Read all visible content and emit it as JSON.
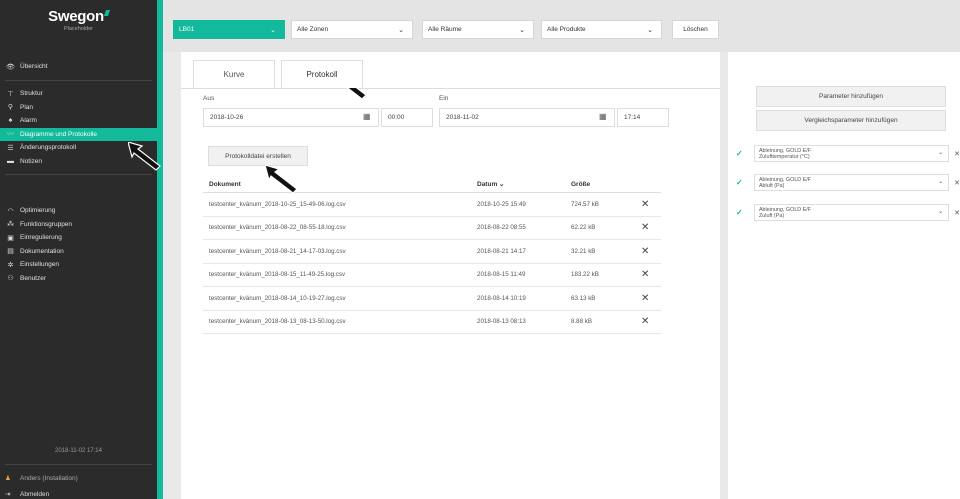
{
  "brand": {
    "name": "Swegon",
    "subtitle": "Placeholder"
  },
  "nav": {
    "overview": {
      "label": "Übersicht",
      "icon": "eye-icon"
    },
    "items": [
      {
        "label": "Struktur",
        "icon": "structure-icon"
      },
      {
        "label": "Plan",
        "icon": "map-pin-icon"
      },
      {
        "label": "Alarm",
        "icon": "bell-icon"
      },
      {
        "label": "Diagramme und Protokolle",
        "icon": "chart-icon",
        "active": true
      },
      {
        "label": "Änderungsprotokoll",
        "icon": "list-icon"
      },
      {
        "label": "Notizen",
        "icon": "note-icon"
      }
    ],
    "items2": [
      {
        "label": "Optimierung",
        "icon": "gauge-icon"
      },
      {
        "label": "Funktionsgruppen",
        "icon": "group-icon"
      },
      {
        "label": "Einregulierung",
        "icon": "tune-icon"
      },
      {
        "label": "Dokumentation",
        "icon": "document-icon"
      },
      {
        "label": "Einstellungen",
        "icon": "gear-icon"
      },
      {
        "label": "Benutzer",
        "icon": "users-icon"
      }
    ],
    "datetime": "2018-11-02 17:14",
    "user": "Anders (Installation)",
    "logout": "Abmelden"
  },
  "filters": {
    "unit": "LB01",
    "zones": "Alle Zonen",
    "rooms": "Alle Räume",
    "products": "Alle Produkte",
    "clear": "Löschen"
  },
  "tabs": {
    "curve": "Kurve",
    "log": "Protokoll"
  },
  "range": {
    "from_label": "Aus",
    "from_date": "2018-10-26",
    "from_time": "00:00",
    "to_label": "Ein",
    "to_date": "2018-11-02",
    "to_time": "17:14"
  },
  "create_button": "Protokolldatei erstellen",
  "table": {
    "headers": {
      "doc": "Dokument",
      "date": "Datum ⌄",
      "size": "Größe"
    },
    "rows": [
      {
        "doc": "testcenter_kvänum_2018-10-25_15-49-06.log.csv",
        "date": "2018-10-25 15:49",
        "size": "724.57 kB"
      },
      {
        "doc": "testcenter_kvänum_2018-08-22_08-55-18.log.csv",
        "date": "2018-08-22 08:55",
        "size": "62.22 kB"
      },
      {
        "doc": "testcenter_kvänum_2018-08-21_14-17-03.log.csv",
        "date": "2018-08-21 14:17",
        "size": "32.21 kB"
      },
      {
        "doc": "testcenter_kvänum_2018-08-15_11-49-25.log.csv",
        "date": "2018-08-15 11:49",
        "size": "183.22 kB"
      },
      {
        "doc": "testcenter_kvänum_2018-08-14_10-19-27.log.csv",
        "date": "2018-08-14 10:19",
        "size": "63.13 kB"
      },
      {
        "doc": "testcenter_kvänum_2018-08-13_08-13-50.log.csv",
        "date": "2018-08-13 08:13",
        "size": "8.88 kB"
      }
    ],
    "delete_glyph": "✕"
  },
  "right": {
    "add_param": "Parameter hinzufügen",
    "add_compare": "Vergleichsparameter hinzufügen",
    "params": [
      {
        "line1": "Ableinung, GOLD E/F",
        "line2": "Zulufttemperatur (°C)"
      },
      {
        "line1": "Ableinung, GOLD E/F",
        "line2": "Abluft (Pa)"
      },
      {
        "line1": "Ableinung, GOLD E/F",
        "line2": "Zuluft (Pa)"
      }
    ]
  },
  "colors": {
    "accent": "#12b99a",
    "sidebar": "#2b2b2b"
  }
}
